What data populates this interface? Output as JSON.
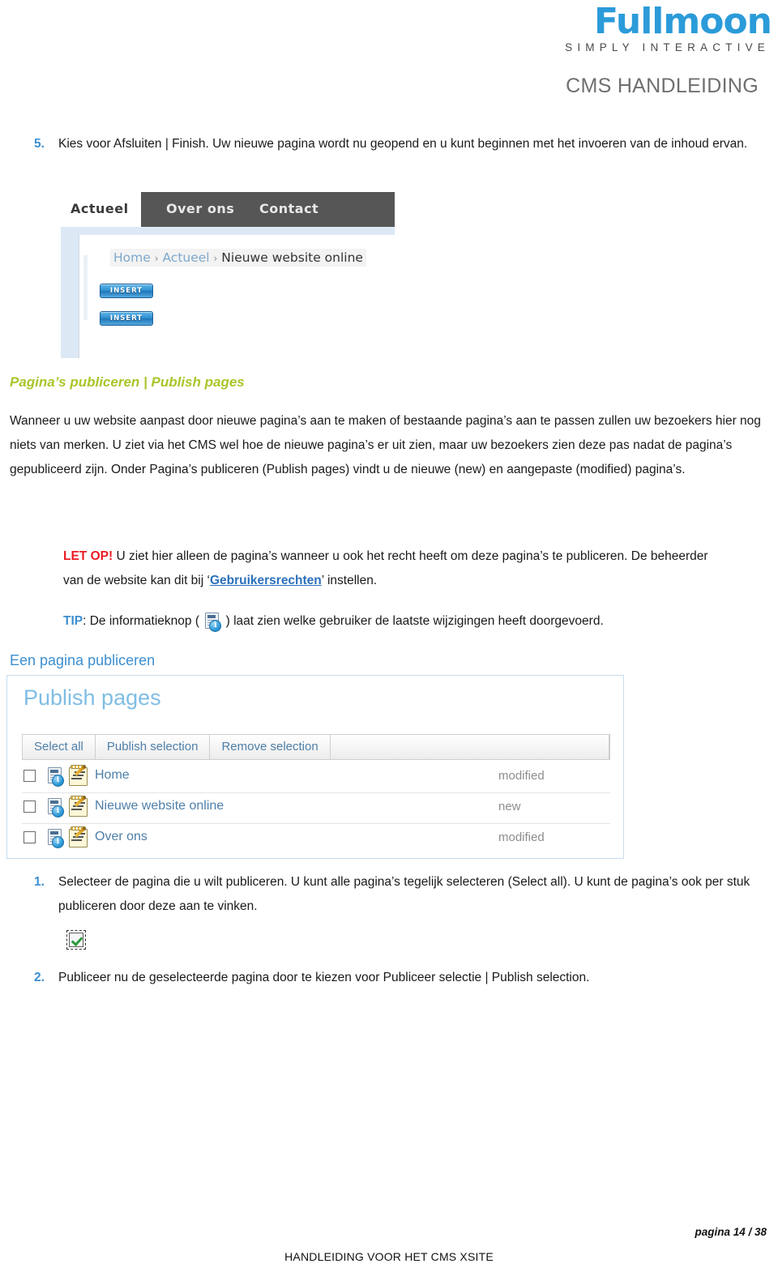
{
  "header": {
    "logo_main_f": "F",
    "logo_main_rest": "ULLMOON",
    "logo_tagline": "SIMPLY INTERACTIVE",
    "doc_subtitle": "CMS HANDLEIDING",
    "logo_color": "#2b9bd9",
    "subtitle_color": "#6f6f6f"
  },
  "step5": {
    "number": "5.",
    "text": "Kies voor Afsluiten | Finish. Uw nieuwe pagina wordt nu geopend en u kunt beginnen met het invoeren van de inhoud ervan."
  },
  "screenshot_site": {
    "tabs": [
      {
        "label": "Actueel",
        "active": true
      },
      {
        "label": "Over ons",
        "active": false
      },
      {
        "label": "Contact",
        "active": false
      }
    ],
    "breadcrumb": {
      "item1": "Home",
      "sep1": "›",
      "item2": "Actueel",
      "sep2": "›",
      "current": "Nieuwe website online"
    },
    "insert_buttons": [
      {
        "label": "INSERT"
      },
      {
        "label": "INSERT"
      }
    ]
  },
  "section": {
    "heading": "Pagina’s publiceren | Publish pages",
    "heading_color": "#a8c62a",
    "intro": "Wanneer u uw website aanpast door nieuwe pagina’s aan te maken of bestaande pagina’s aan te passen zullen uw bezoekers hier nog niets van merken. U ziet via het CMS wel hoe de nieuwe pagina’s er uit zien, maar uw bezoekers zien deze pas nadat de pagina’s gepubliceerd zijn. Onder Pagina’s publiceren (Publish pages) vindt u de nieuwe (new) en aangepaste (modified) pagina’s."
  },
  "notice": {
    "label": "LET OP!",
    "label_color": "#ec1c24",
    "text_before_link": " U ziet hier alleen de pagina’s wanneer u ook het recht heeft om deze pagina’s te publiceren. De beheerder van de website kan dit bij ‘",
    "link": "Gebruikersrechten",
    "text_after_link": "’ instellen."
  },
  "tip": {
    "label": "TIP",
    "label_color": "#3d8fd0",
    "text_before_icon": ": De informatieknop ( ",
    "icon": "info-icon",
    "icon_glyph": "i",
    "text_after_icon": " ) laat zien welke gebruiker de laatste wijzigingen heeft doorgevoerd."
  },
  "subsection": {
    "heading": "Een pagina publiceren",
    "heading_color": "#3d8fd0"
  },
  "publish_panel": {
    "title": "Publish pages",
    "title_color": "#7fbde4",
    "toolbar": [
      {
        "label": "Select all"
      },
      {
        "label": "Publish selection"
      },
      {
        "label": "Remove selection"
      }
    ],
    "rows": [
      {
        "name": "Home",
        "status": "modified",
        "checked": false
      },
      {
        "name": "Nieuwe website online",
        "status": "new",
        "checked": false
      },
      {
        "name": "Over ons",
        "status": "modified",
        "checked": false
      }
    ]
  },
  "steps_bottom": [
    {
      "number": "1.",
      "text": "Selecteer de pagina die u wilt publiceren. U kunt alle pagina’s tegelijk selecteren (Select all). U kunt de pagina’s ook per stuk publiceren door deze aan te vinken."
    },
    {
      "number": "2.",
      "text": "Publiceer nu de geselecteerde pagina door te kiezen voor Publiceer selectie | Publish selection."
    }
  ],
  "footer": {
    "page_number": "pagina 14 / 38",
    "center_text": "HANDLEIDING VOOR HET CMS XSITE"
  }
}
